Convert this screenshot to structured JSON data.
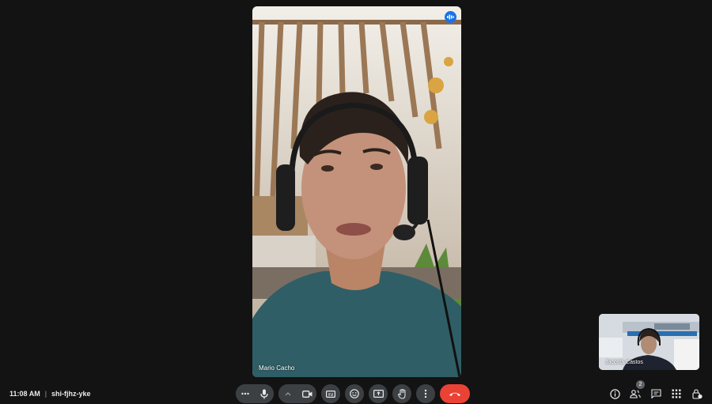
{
  "main_participant": {
    "name": "Mario Cacho"
  },
  "self_view": {
    "name": "Jacosta Castos"
  },
  "meeting": {
    "time": "11:08 AM",
    "separator": "|",
    "code": "shi-fjhz-yke"
  },
  "participants": {
    "count": "2"
  },
  "controls": [
    {
      "name": "more-options-left",
      "icon": "dots-horizontal-icon"
    },
    {
      "name": "microphone",
      "icon": "mic-icon"
    },
    {
      "name": "video-options",
      "icon": "chevron-up-icon"
    },
    {
      "name": "camera",
      "icon": "videocam-icon"
    },
    {
      "name": "captions",
      "icon": "captions-icon"
    },
    {
      "name": "reactions",
      "icon": "emoji-icon"
    },
    {
      "name": "present",
      "icon": "present-screen-icon"
    },
    {
      "name": "raise-hand",
      "icon": "hand-icon"
    },
    {
      "name": "more-options",
      "icon": "dots-vertical-icon"
    },
    {
      "name": "leave-call",
      "icon": "end-call-icon"
    }
  ],
  "colors": {
    "background": "#131313",
    "control": "#3c4043",
    "end_call": "#ea4335",
    "speaking": "#1a73e8"
  }
}
